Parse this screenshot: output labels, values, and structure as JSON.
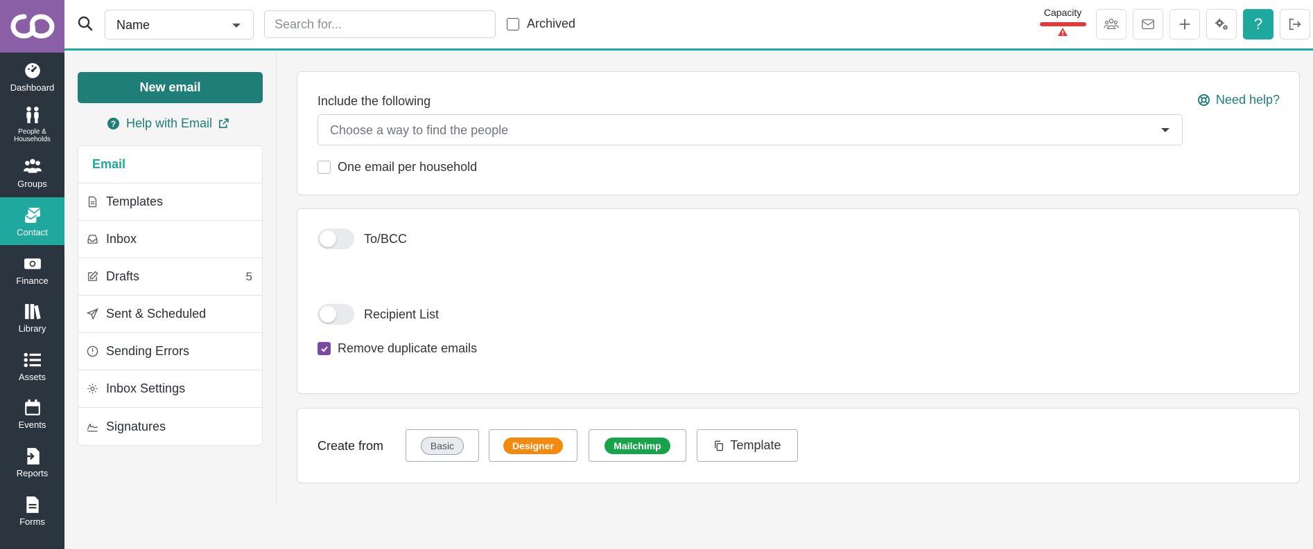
{
  "nav": {
    "items": [
      {
        "label": "Dashboard",
        "icon": "dashboard-icon"
      },
      {
        "label": "People & Households",
        "icon": "people-icon"
      },
      {
        "label": "Groups",
        "icon": "groups-icon"
      },
      {
        "label": "Contact",
        "icon": "contact-icon",
        "active": true
      },
      {
        "label": "Finance",
        "icon": "finance-icon"
      },
      {
        "label": "Library",
        "icon": "library-icon"
      },
      {
        "label": "Assets",
        "icon": "assets-icon"
      },
      {
        "label": "Events",
        "icon": "events-icon"
      },
      {
        "label": "Reports",
        "icon": "reports-icon"
      },
      {
        "label": "Forms",
        "icon": "forms-icon"
      }
    ]
  },
  "topbar": {
    "search_field_select": "Name",
    "search_placeholder": "Search for...",
    "archived_label": "Archived",
    "capacity_label": "Capacity",
    "help_label": "?"
  },
  "sidebar": {
    "new_email_label": "New email",
    "help_link_label": "Help with Email",
    "section_header": "Email",
    "items": [
      {
        "label": "Templates",
        "icon": "document-icon"
      },
      {
        "label": "Inbox",
        "icon": "inbox-icon"
      },
      {
        "label": "Drafts",
        "icon": "edit-icon",
        "count": "5"
      },
      {
        "label": "Sent & Scheduled",
        "icon": "send-icon"
      },
      {
        "label": "Sending Errors",
        "icon": "alert-circle-icon"
      },
      {
        "label": "Inbox Settings",
        "icon": "gear-icon"
      },
      {
        "label": "Signatures",
        "icon": "signature-icon"
      }
    ]
  },
  "main": {
    "include_label": "Include the following",
    "need_help_label": "Need help?",
    "people_select_placeholder": "Choose a way to find the people",
    "one_per_household_label": "One email per household",
    "to_bcc_label": "To/BCC",
    "recipient_list_label": "Recipient List",
    "remove_duplicates_label": "Remove duplicate emails",
    "create_from_label": "Create from",
    "basic_label": "Basic",
    "designer_label": "Designer",
    "mailchimp_label": "Mailchimp",
    "template_label": "Template"
  },
  "colors": {
    "accent": "#1fa89d",
    "primary_button": "#1f7e78",
    "logo_bg": "#8b5fa5",
    "nav_bg": "#2b3540",
    "checkbox_checked": "#7a4aa3",
    "designer": "#f28a10",
    "mailchimp": "#17a34a",
    "capacity_bar": "#e33b3b"
  }
}
